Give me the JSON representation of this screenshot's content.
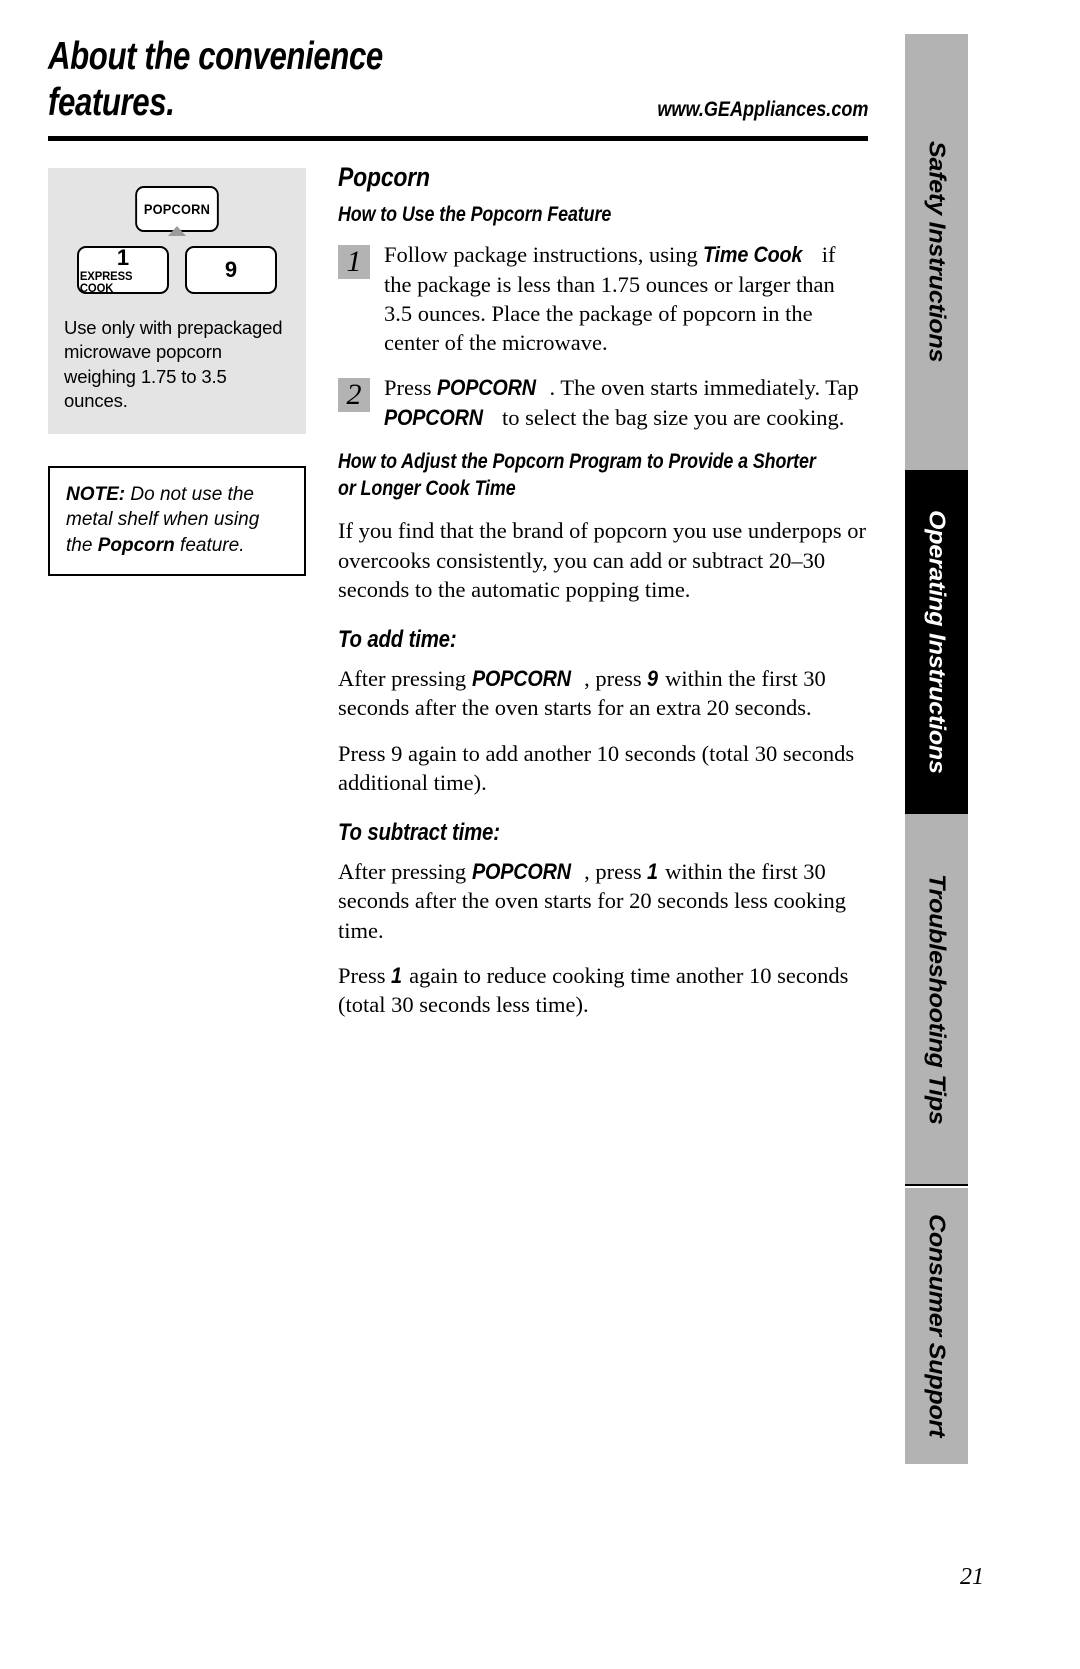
{
  "header": {
    "title": "About the convenience\nfeatures.",
    "url": "www.GEAppliances.com"
  },
  "figure": {
    "popcorn_key_label": "POPCORN",
    "key_one_digit": "1",
    "key_one_sub": "EXPRESS COOK",
    "key_nine_digit": "9",
    "caption": "Use only with prepackaged microwave popcorn weighing 1.75 to 3.5 ounces."
  },
  "note": {
    "label": "NOTE:",
    "text_before": " Do not use the metal shelf when using the ",
    "emphasis": "Popcorn",
    "text_after": " feature."
  },
  "main": {
    "section_title": "Popcorn",
    "subheading_use": "How to Use the Popcorn Feature",
    "steps": [
      {
        "number": "1",
        "part1": "Follow package instructions, using ",
        "keyword": "Time Cook",
        "part2": " if the package is less than 1.75 ounces or larger than 3.5 ounces. Place the package of popcorn in the center of the microwave."
      },
      {
        "number": "2",
        "part1": "Press ",
        "keyword": "POPCORN",
        "part2": ". The oven starts immediately. Tap ",
        "keyword2": "POPCORN",
        "part3": " to select the bag size you are cooking."
      }
    ],
    "subheading_adjust_line1": "How to Adjust the Popcorn Program to Provide a Shorter",
    "subheading_adjust_line2": "or Longer Cook Time",
    "adjust_paragraph": "If you find that the brand of popcorn you use underpops or overcooks consistently, you can add or subtract 20–30 seconds to the automatic popping time.",
    "add_time": {
      "heading": "To add time:",
      "p1_part1": "After pressing ",
      "p1_keyword": "POPCORN",
      "p1_part2": ", press ",
      "p1_keyword2": "9",
      "p1_part3": " within the first 30 seconds after the oven starts for an extra 20 seconds.",
      "p2": "Press 9 again to add another 10 seconds (total 30 seconds additional time)."
    },
    "subtract_time": {
      "heading": "To subtract time:",
      "p1_part1": "After pressing ",
      "p1_keyword": "POPCORN",
      "p1_part2": ", press ",
      "p1_keyword2": "1",
      "p1_part3": " within the first 30 seconds after the oven starts for 20 seconds less cooking time.",
      "p2_part1": "Press ",
      "p2_keyword": "1",
      "p2_part2": " again to reduce cooking time another 10 seconds (total 30 seconds less time)."
    }
  },
  "tabs": [
    {
      "label": "Safety Instructions",
      "active": false
    },
    {
      "label": "Operating Instructions",
      "active": true
    },
    {
      "label": "Troubleshooting Tips",
      "active": false
    },
    {
      "label": "Consumer Support",
      "active": false
    }
  ],
  "footer": {
    "page_number": "21"
  },
  "colors": {
    "figure_bg": "#e4e4e4",
    "tab_inactive": "#b3b3b3",
    "tab_active": "#000000",
    "step_badge": "#b3b3b3"
  }
}
